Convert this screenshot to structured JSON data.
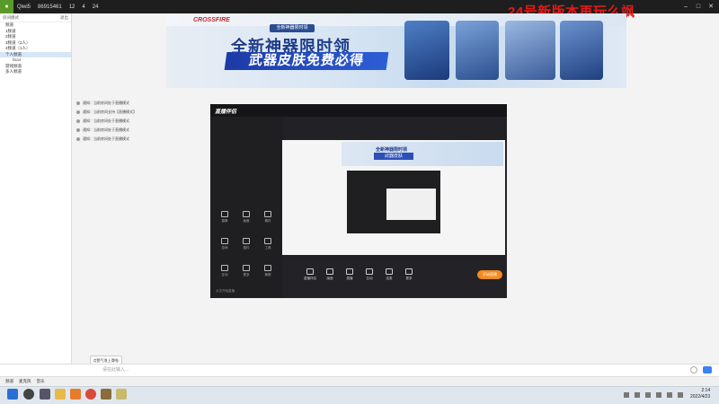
{
  "topbar": {
    "seg1": "Qiwi5",
    "seg2": "86915461",
    "seg3": "12",
    "seg4": "4",
    "seg5": "24"
  },
  "overlay_title": "24号新版本再玩么飒",
  "leftpanel": {
    "header": "房间模式",
    "header_right": "退出",
    "items": [
      "频道",
      "1频道",
      "2频道",
      "3频道（2人）",
      "4频道（1人）",
      "个人频道",
      "游戏频道",
      "多人频道"
    ],
    "sub_user": "lisa4"
  },
  "banner": {
    "brand": "CROSSFIRE",
    "tag": "全新神器限时领",
    "title1": "全新神器限时领",
    "title2": "武器皮肤免费必得"
  },
  "chat_lines": [
    "通知：当前房间处于直播模式",
    "通知：当前房间支持【直播模式】",
    "通知：当前房间处于直播模式",
    "通知：当前房间处于直播模式",
    "通知：当前房间处于直播模式"
  ],
  "stream": {
    "logo": "直播伴侣",
    "left_tools": [
      "摄像",
      "画面",
      "素材",
      "游戏",
      "插件",
      "工具",
      "互动",
      "更多",
      "美颜"
    ],
    "left_footer": "点击开始直播",
    "bottom_tools": [
      "直播伴侣",
      "画面",
      "直播",
      "互动",
      "连麦",
      "更多"
    ],
    "start_button": "开始直播"
  },
  "nested_banner": {
    "t1": "全新神器限时领",
    "t2": "武器皮肤"
  },
  "tooltip": "点赞气泡上滑啦!",
  "input_placeholder": "请在此输入...",
  "statusbar": {
    "s1": "频道",
    "s2": "麦克风",
    "s3": "音乐"
  },
  "clock": {
    "time": "2:14",
    "date": "2022/4/23"
  }
}
